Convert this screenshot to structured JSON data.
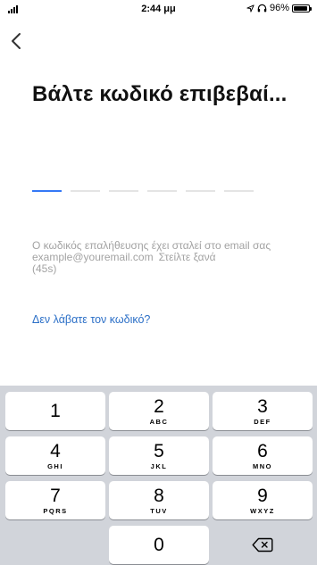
{
  "status_bar": {
    "time": "2:44 μμ",
    "battery": "96%",
    "battery_level": 0.96,
    "icons": [
      "signal-icon",
      "location-icon",
      "headphones-icon",
      "battery-icon"
    ]
  },
  "nav": {
    "back_icon": "chevron-left-icon"
  },
  "title": "Βάλτε κωδικό επιβεβαί...",
  "code": {
    "length": 6,
    "active_index": 0
  },
  "info": {
    "text": "Ο κωδικός επαλήθευσης έχει σταλεί στο email σας example@youremail.com",
    "resend": "Στείλτε ξανά",
    "countdown": "(45s)"
  },
  "not_received_link": "Δεν λάβατε τον κωδικό?",
  "keyboard": {
    "keys": [
      {
        "num": "1",
        "letters": ""
      },
      {
        "num": "2",
        "letters": "ABC"
      },
      {
        "num": "3",
        "letters": "DEF"
      },
      {
        "num": "4",
        "letters": "GHI"
      },
      {
        "num": "5",
        "letters": "JKL"
      },
      {
        "num": "6",
        "letters": "MNO"
      },
      {
        "num": "7",
        "letters": "PQRS"
      },
      {
        "num": "8",
        "letters": "TUV"
      },
      {
        "num": "9",
        "letters": "WXYZ"
      },
      {
        "num": "0",
        "letters": ""
      }
    ],
    "delete_icon": "backspace-icon"
  },
  "colors": {
    "accent": "#3478f6",
    "link": "#2b6fc7",
    "muted": "#a3a3a3",
    "keyboard_bg": "#d1d4da"
  }
}
